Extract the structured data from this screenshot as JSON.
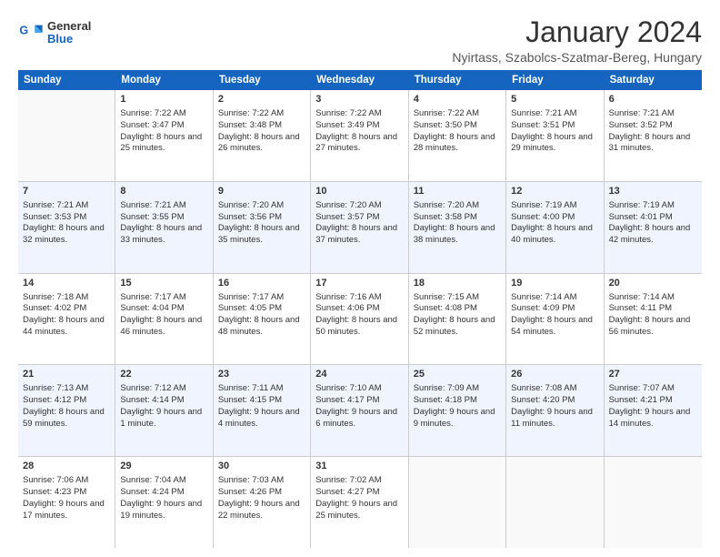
{
  "logo": {
    "line1": "General",
    "line2": "Blue"
  },
  "title": "January 2024",
  "location": "Nyirtass, Szabolcs-Szatmar-Bereg, Hungary",
  "weekdays": [
    "Sunday",
    "Monday",
    "Tuesday",
    "Wednesday",
    "Thursday",
    "Friday",
    "Saturday"
  ],
  "weeks": [
    [
      {
        "day": "",
        "sunrise": "",
        "sunset": "",
        "daylight": ""
      },
      {
        "day": "1",
        "sunrise": "Sunrise: 7:22 AM",
        "sunset": "Sunset: 3:47 PM",
        "daylight": "Daylight: 8 hours and 25 minutes."
      },
      {
        "day": "2",
        "sunrise": "Sunrise: 7:22 AM",
        "sunset": "Sunset: 3:48 PM",
        "daylight": "Daylight: 8 hours and 26 minutes."
      },
      {
        "day": "3",
        "sunrise": "Sunrise: 7:22 AM",
        "sunset": "Sunset: 3:49 PM",
        "daylight": "Daylight: 8 hours and 27 minutes."
      },
      {
        "day": "4",
        "sunrise": "Sunrise: 7:22 AM",
        "sunset": "Sunset: 3:50 PM",
        "daylight": "Daylight: 8 hours and 28 minutes."
      },
      {
        "day": "5",
        "sunrise": "Sunrise: 7:21 AM",
        "sunset": "Sunset: 3:51 PM",
        "daylight": "Daylight: 8 hours and 29 minutes."
      },
      {
        "day": "6",
        "sunrise": "Sunrise: 7:21 AM",
        "sunset": "Sunset: 3:52 PM",
        "daylight": "Daylight: 8 hours and 31 minutes."
      }
    ],
    [
      {
        "day": "7",
        "sunrise": "Sunrise: 7:21 AM",
        "sunset": "Sunset: 3:53 PM",
        "daylight": "Daylight: 8 hours and 32 minutes."
      },
      {
        "day": "8",
        "sunrise": "Sunrise: 7:21 AM",
        "sunset": "Sunset: 3:55 PM",
        "daylight": "Daylight: 8 hours and 33 minutes."
      },
      {
        "day": "9",
        "sunrise": "Sunrise: 7:20 AM",
        "sunset": "Sunset: 3:56 PM",
        "daylight": "Daylight: 8 hours and 35 minutes."
      },
      {
        "day": "10",
        "sunrise": "Sunrise: 7:20 AM",
        "sunset": "Sunset: 3:57 PM",
        "daylight": "Daylight: 8 hours and 37 minutes."
      },
      {
        "day": "11",
        "sunrise": "Sunrise: 7:20 AM",
        "sunset": "Sunset: 3:58 PM",
        "daylight": "Daylight: 8 hours and 38 minutes."
      },
      {
        "day": "12",
        "sunrise": "Sunrise: 7:19 AM",
        "sunset": "Sunset: 4:00 PM",
        "daylight": "Daylight: 8 hours and 40 minutes."
      },
      {
        "day": "13",
        "sunrise": "Sunrise: 7:19 AM",
        "sunset": "Sunset: 4:01 PM",
        "daylight": "Daylight: 8 hours and 42 minutes."
      }
    ],
    [
      {
        "day": "14",
        "sunrise": "Sunrise: 7:18 AM",
        "sunset": "Sunset: 4:02 PM",
        "daylight": "Daylight: 8 hours and 44 minutes."
      },
      {
        "day": "15",
        "sunrise": "Sunrise: 7:17 AM",
        "sunset": "Sunset: 4:04 PM",
        "daylight": "Daylight: 8 hours and 46 minutes."
      },
      {
        "day": "16",
        "sunrise": "Sunrise: 7:17 AM",
        "sunset": "Sunset: 4:05 PM",
        "daylight": "Daylight: 8 hours and 48 minutes."
      },
      {
        "day": "17",
        "sunrise": "Sunrise: 7:16 AM",
        "sunset": "Sunset: 4:06 PM",
        "daylight": "Daylight: 8 hours and 50 minutes."
      },
      {
        "day": "18",
        "sunrise": "Sunrise: 7:15 AM",
        "sunset": "Sunset: 4:08 PM",
        "daylight": "Daylight: 8 hours and 52 minutes."
      },
      {
        "day": "19",
        "sunrise": "Sunrise: 7:14 AM",
        "sunset": "Sunset: 4:09 PM",
        "daylight": "Daylight: 8 hours and 54 minutes."
      },
      {
        "day": "20",
        "sunrise": "Sunrise: 7:14 AM",
        "sunset": "Sunset: 4:11 PM",
        "daylight": "Daylight: 8 hours and 56 minutes."
      }
    ],
    [
      {
        "day": "21",
        "sunrise": "Sunrise: 7:13 AM",
        "sunset": "Sunset: 4:12 PM",
        "daylight": "Daylight: 8 hours and 59 minutes."
      },
      {
        "day": "22",
        "sunrise": "Sunrise: 7:12 AM",
        "sunset": "Sunset: 4:14 PM",
        "daylight": "Daylight: 9 hours and 1 minute."
      },
      {
        "day": "23",
        "sunrise": "Sunrise: 7:11 AM",
        "sunset": "Sunset: 4:15 PM",
        "daylight": "Daylight: 9 hours and 4 minutes."
      },
      {
        "day": "24",
        "sunrise": "Sunrise: 7:10 AM",
        "sunset": "Sunset: 4:17 PM",
        "daylight": "Daylight: 9 hours and 6 minutes."
      },
      {
        "day": "25",
        "sunrise": "Sunrise: 7:09 AM",
        "sunset": "Sunset: 4:18 PM",
        "daylight": "Daylight: 9 hours and 9 minutes."
      },
      {
        "day": "26",
        "sunrise": "Sunrise: 7:08 AM",
        "sunset": "Sunset: 4:20 PM",
        "daylight": "Daylight: 9 hours and 11 minutes."
      },
      {
        "day": "27",
        "sunrise": "Sunrise: 7:07 AM",
        "sunset": "Sunset: 4:21 PM",
        "daylight": "Daylight: 9 hours and 14 minutes."
      }
    ],
    [
      {
        "day": "28",
        "sunrise": "Sunrise: 7:06 AM",
        "sunset": "Sunset: 4:23 PM",
        "daylight": "Daylight: 9 hours and 17 minutes."
      },
      {
        "day": "29",
        "sunrise": "Sunrise: 7:04 AM",
        "sunset": "Sunset: 4:24 PM",
        "daylight": "Daylight: 9 hours and 19 minutes."
      },
      {
        "day": "30",
        "sunrise": "Sunrise: 7:03 AM",
        "sunset": "Sunset: 4:26 PM",
        "daylight": "Daylight: 9 hours and 22 minutes."
      },
      {
        "day": "31",
        "sunrise": "Sunrise: 7:02 AM",
        "sunset": "Sunset: 4:27 PM",
        "daylight": "Daylight: 9 hours and 25 minutes."
      },
      {
        "day": "",
        "sunrise": "",
        "sunset": "",
        "daylight": ""
      },
      {
        "day": "",
        "sunrise": "",
        "sunset": "",
        "daylight": ""
      },
      {
        "day": "",
        "sunrise": "",
        "sunset": "",
        "daylight": ""
      }
    ]
  ]
}
